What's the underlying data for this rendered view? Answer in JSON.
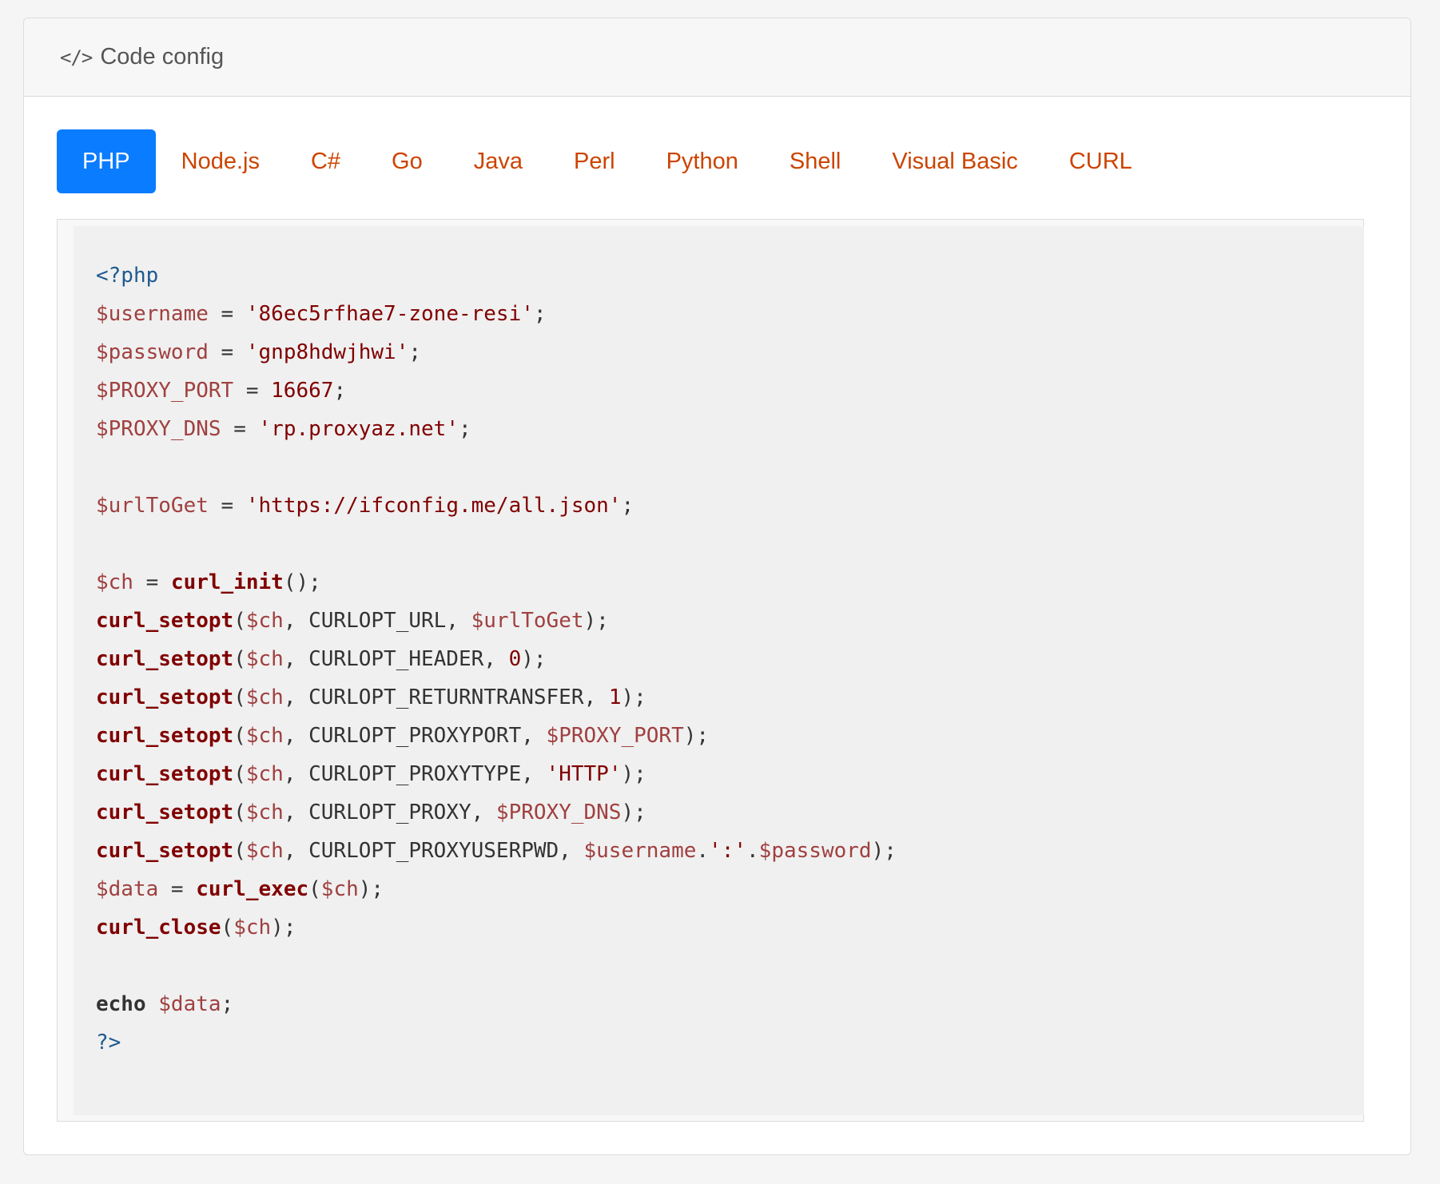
{
  "header": {
    "icon": "code-icon",
    "icon_glyph": "</>",
    "title": "Code config"
  },
  "tabs": [
    {
      "label": "PHP",
      "active": true
    },
    {
      "label": "Node.js",
      "active": false
    },
    {
      "label": "C#",
      "active": false
    },
    {
      "label": "Go",
      "active": false
    },
    {
      "label": "Java",
      "active": false
    },
    {
      "label": "Perl",
      "active": false
    },
    {
      "label": "Python",
      "active": false
    },
    {
      "label": "Shell",
      "active": false
    },
    {
      "label": "Visual Basic",
      "active": false
    },
    {
      "label": "CURL",
      "active": false
    }
  ],
  "colors": {
    "active_tab_bg": "#0a7cff",
    "tab_text": "#cc4400",
    "php_tag": "#1f5a8f",
    "variable": "#a04040",
    "string": "#800000"
  },
  "code": {
    "language": "PHP",
    "lines": [
      [
        [
          "tag",
          "<?php"
        ]
      ],
      [
        [
          "var",
          "$username"
        ],
        [
          "pl",
          " = "
        ],
        [
          "str",
          "'86ec5rfhae7-zone-resi'"
        ],
        [
          "pl",
          ";"
        ]
      ],
      [
        [
          "var",
          "$password"
        ],
        [
          "pl",
          " = "
        ],
        [
          "str",
          "'gnp8hdwjhwi'"
        ],
        [
          "pl",
          ";"
        ]
      ],
      [
        [
          "var",
          "$PROXY_PORT"
        ],
        [
          "pl",
          " = "
        ],
        [
          "num",
          "16667"
        ],
        [
          "pl",
          ";"
        ]
      ],
      [
        [
          "var",
          "$PROXY_DNS"
        ],
        [
          "pl",
          " = "
        ],
        [
          "str",
          "'rp.proxyaz.net'"
        ],
        [
          "pl",
          ";"
        ]
      ],
      [],
      [
        [
          "var",
          "$urlToGet"
        ],
        [
          "pl",
          " = "
        ],
        [
          "str",
          "'https://ifconfig.me/all.json'"
        ],
        [
          "pl",
          ";"
        ]
      ],
      [],
      [
        [
          "var",
          "$ch"
        ],
        [
          "pl",
          " = "
        ],
        [
          "fn",
          "curl_init"
        ],
        [
          "pl",
          "();"
        ]
      ],
      [
        [
          "fn",
          "curl_setopt"
        ],
        [
          "pl",
          "("
        ],
        [
          "var",
          "$ch"
        ],
        [
          "pl",
          ", CURLOPT_URL, "
        ],
        [
          "var",
          "$urlToGet"
        ],
        [
          "pl",
          ");"
        ]
      ],
      [
        [
          "fn",
          "curl_setopt"
        ],
        [
          "pl",
          "("
        ],
        [
          "var",
          "$ch"
        ],
        [
          "pl",
          ", CURLOPT_HEADER, "
        ],
        [
          "num",
          "0"
        ],
        [
          "pl",
          ");"
        ]
      ],
      [
        [
          "fn",
          "curl_setopt"
        ],
        [
          "pl",
          "("
        ],
        [
          "var",
          "$ch"
        ],
        [
          "pl",
          ", CURLOPT_RETURNTRANSFER, "
        ],
        [
          "num",
          "1"
        ],
        [
          "pl",
          ");"
        ]
      ],
      [
        [
          "fn",
          "curl_setopt"
        ],
        [
          "pl",
          "("
        ],
        [
          "var",
          "$ch"
        ],
        [
          "pl",
          ", CURLOPT_PROXYPORT, "
        ],
        [
          "var",
          "$PROXY_PORT"
        ],
        [
          "pl",
          ");"
        ]
      ],
      [
        [
          "fn",
          "curl_setopt"
        ],
        [
          "pl",
          "("
        ],
        [
          "var",
          "$ch"
        ],
        [
          "pl",
          ", CURLOPT_PROXYTYPE, "
        ],
        [
          "str",
          "'HTTP'"
        ],
        [
          "pl",
          ");"
        ]
      ],
      [
        [
          "fn",
          "curl_setopt"
        ],
        [
          "pl",
          "("
        ],
        [
          "var",
          "$ch"
        ],
        [
          "pl",
          ", CURLOPT_PROXY, "
        ],
        [
          "var",
          "$PROXY_DNS"
        ],
        [
          "pl",
          ");"
        ]
      ],
      [
        [
          "fn",
          "curl_setopt"
        ],
        [
          "pl",
          "("
        ],
        [
          "var",
          "$ch"
        ],
        [
          "pl",
          ", CURLOPT_PROXYUSERPWD, "
        ],
        [
          "var",
          "$username"
        ],
        [
          "pl",
          "."
        ],
        [
          "str",
          "':'"
        ],
        [
          "pl",
          "."
        ],
        [
          "var",
          "$password"
        ],
        [
          "pl",
          ");"
        ]
      ],
      [
        [
          "var",
          "$data"
        ],
        [
          "pl",
          " = "
        ],
        [
          "fn",
          "curl_exec"
        ],
        [
          "pl",
          "("
        ],
        [
          "var",
          "$ch"
        ],
        [
          "pl",
          ");"
        ]
      ],
      [
        [
          "fn",
          "curl_close"
        ],
        [
          "pl",
          "("
        ],
        [
          "var",
          "$ch"
        ],
        [
          "pl",
          ");"
        ]
      ],
      [],
      [
        [
          "kw",
          "echo"
        ],
        [
          "pl",
          " "
        ],
        [
          "var",
          "$data"
        ],
        [
          "pl",
          ";"
        ]
      ],
      [
        [
          "tag",
          "?>"
        ]
      ]
    ]
  }
}
